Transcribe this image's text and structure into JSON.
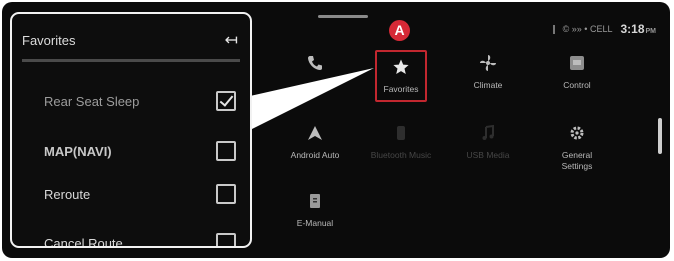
{
  "status": {
    "signal": "ill ",
    "info": "© »» • CELL",
    "time": "3:18",
    "time_suffix": "PM"
  },
  "badge": "A",
  "home_tiles": [
    {
      "label": "",
      "icon": "phone-icon"
    },
    {
      "label": "Favorites",
      "icon": "star-icon"
    },
    {
      "label": "Climate",
      "icon": "fan-icon"
    },
    {
      "label": "Control",
      "icon": "car-control-icon"
    },
    {
      "label": "Android Auto",
      "icon": "android-auto-icon"
    },
    {
      "label": "Bluetooth Music",
      "icon": "bluetooth-music-icon"
    },
    {
      "label": "USB Media",
      "icon": "usb-media-icon"
    },
    {
      "label": "General\nSettings",
      "icon": "gear-icon"
    },
    {
      "label": "E-Manual",
      "icon": "manual-icon"
    }
  ],
  "favorites_panel": {
    "title": "Favorites",
    "items": [
      {
        "label": "Rear Seat Sleep",
        "checked": true
      },
      {
        "label": "MAP(NAVI)",
        "checked": false
      },
      {
        "label": "Reroute",
        "checked": false
      },
      {
        "label": "Cancel Route",
        "checked": false
      }
    ]
  }
}
